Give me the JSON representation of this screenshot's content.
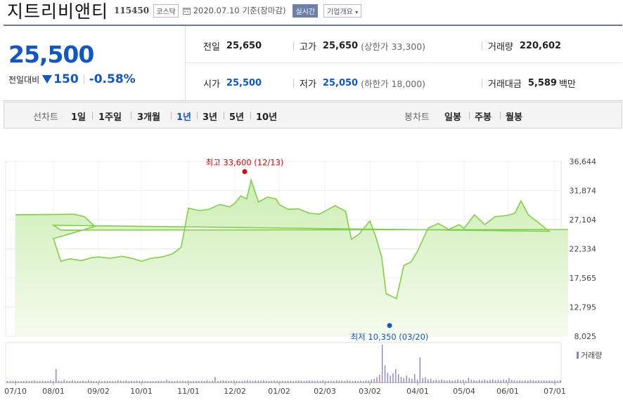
{
  "header": {
    "name": "지트리비앤티",
    "code": "115450",
    "market": "코스닥",
    "date": "2020.07.10",
    "basis": "기준(장마감)",
    "realtime_label": "실시간",
    "overview_label": "기업개요"
  },
  "quote": {
    "price": "25,500",
    "change_label": "전일대비",
    "change_abs": "150",
    "change_pct": "-0.58%",
    "direction": "down",
    "prev_close_label": "전일",
    "prev_close": "25,650",
    "high_label": "고가",
    "high": "25,650",
    "upper_limit": "(상한가 33,300)",
    "volume_label": "거래량",
    "volume": "220,602",
    "open_label": "시가",
    "open": "25,500",
    "low_label": "저가",
    "low": "25,050",
    "lower_limit": "(하한가 18,000)",
    "value_label": "거래대금",
    "value": "5,589",
    "value_unit": "백만"
  },
  "tabs": {
    "line_label": "선차트",
    "line_items": [
      "1일",
      "1주일",
      "3개월",
      "1년",
      "3년",
      "5년",
      "10년"
    ],
    "line_active": "1년",
    "candle_label": "봉차트",
    "candle_items": [
      "일봉",
      "주봉",
      "월봉"
    ]
  },
  "colors": {
    "up": "#e60000",
    "down": "#0f55cc",
    "line": "#7fd244",
    "volume": "#8c83c9"
  },
  "chart_data": {
    "type": "area",
    "x_ticks": [
      "07/10",
      "08/01",
      "09/02",
      "10/01",
      "11/01",
      "12/02",
      "01/02",
      "02/03",
      "03/02",
      "04/01",
      "05/04",
      "06/01",
      "07/01"
    ],
    "y_ticks": [
      "36,644",
      "31,874",
      "27,104",
      "22,334",
      "17,565",
      "12,795",
      "8,025"
    ],
    "ylim": [
      8025,
      36644
    ],
    "high_annotation": "최고 33,600 (12/13)",
    "low_annotation": "최저 10,350 (03/20)",
    "high": {
      "date": "12/13",
      "value": 33600
    },
    "low": {
      "date": "03/20",
      "value": 10350
    },
    "series": [
      {
        "name": "",
        "points": [
          [
            "07/10",
            27900
          ],
          [
            "07/15",
            28000
          ],
          [
            "07/22",
            27600
          ],
          [
            "07/29",
            26000
          ],
          [
            "08/01",
            24000
          ],
          [
            "08/06",
            20300
          ],
          [
            "08/12",
            20700
          ],
          [
            "08/20",
            20400
          ],
          [
            "08/27",
            20900
          ],
          [
            "09/02",
            21000
          ],
          [
            "09/10",
            20800
          ],
          [
            "09/18",
            21100
          ],
          [
            "09/26",
            20700
          ],
          [
            "10/01",
            20300
          ],
          [
            "10/08",
            20800
          ],
          [
            "10/15",
            21000
          ],
          [
            "10/22",
            21500
          ],
          [
            "10/28",
            22600
          ],
          [
            "11/01",
            29000
          ],
          [
            "11/08",
            28600
          ],
          [
            "11/15",
            28800
          ],
          [
            "11/22",
            29600
          ],
          [
            "11/29",
            29200
          ],
          [
            "12/02",
            29800
          ],
          [
            "12/06",
            31000
          ],
          [
            "12/10",
            30500
          ],
          [
            "12/13",
            33600
          ],
          [
            "12/18",
            30000
          ],
          [
            "12/24",
            30800
          ],
          [
            "12/30",
            30500
          ],
          [
            "01/02",
            29600
          ],
          [
            "01/08",
            28800
          ],
          [
            "01/15",
            28900
          ],
          [
            "01/22",
            28200
          ],
          [
            "01/29",
            28000
          ],
          [
            "02/03",
            28500
          ],
          [
            "02/10",
            29400
          ],
          [
            "02/17",
            28500
          ],
          [
            "02/21",
            23900
          ],
          [
            "02/26",
            24700
          ],
          [
            "03/02",
            26900
          ],
          [
            "03/06",
            24300
          ],
          [
            "03/10",
            21000
          ],
          [
            "03/13",
            15000
          ],
          [
            "03/20",
            14200
          ],
          [
            "03/25",
            19600
          ],
          [
            "03/30",
            20200
          ],
          [
            "04/01",
            22000
          ],
          [
            "04/08",
            25700
          ],
          [
            "04/15",
            26500
          ],
          [
            "04/22",
            25500
          ],
          [
            "04/29",
            26300
          ],
          [
            "05/04",
            25700
          ],
          [
            "05/11",
            27900
          ],
          [
            "05/18",
            26300
          ],
          [
            "05/25",
            27600
          ],
          [
            "06/01",
            27800
          ],
          [
            "06/06",
            28200
          ],
          [
            "06/10",
            30200
          ],
          [
            "06/15",
            27900
          ],
          [
            "06/22",
            26600
          ],
          [
            "06/29",
            25200
          ],
          [
            "07/01",
            26200
          ],
          [
            "07/06",
            25400
          ],
          [
            "07/10",
            25500
          ]
        ]
      }
    ],
    "volume_label": "거래량",
    "volume_rel": [
      0.04,
      0.03,
      0.04,
      0.05,
      0.03,
      0.04,
      0.03,
      0.05,
      0.04,
      0.05,
      0.06,
      0.03,
      0.04,
      0.05,
      0.04,
      0.03,
      0.06,
      0.04,
      0.35,
      0.05,
      0.04,
      0.07,
      0.05,
      0.04,
      0.06,
      0.05,
      0.04,
      0.03,
      0.05,
      0.04,
      0.06,
      0.05,
      0.04,
      0.03,
      0.05,
      0.04,
      0.04,
      0.05,
      0.04,
      0.03,
      0.04,
      0.06,
      0.05,
      0.04,
      0.06,
      0.04,
      0.05,
      0.04,
      0.05,
      0.04,
      0.05,
      0.04,
      0.03,
      0.04,
      0.03,
      0.04,
      0.05,
      0.04,
      0.03,
      0.07,
      0.05,
      0.04,
      0.03,
      0.05,
      0.04,
      0.05,
      0.04,
      0.05,
      0.03,
      0.04,
      0.05,
      0.04,
      0.05,
      0.04,
      0.06,
      0.04,
      0.05,
      0.15,
      0.04,
      0.05,
      0.06,
      0.05,
      0.04,
      0.05,
      0.06,
      0.05,
      0.04,
      0.03,
      0.05,
      0.06,
      0.05,
      0.04,
      0.06,
      0.05,
      0.05,
      0.06,
      0.05,
      0.04,
      0.05,
      0.06,
      0.05,
      0.04,
      0.05,
      0.04,
      0.05,
      0.05,
      0.04,
      0.05,
      0.06,
      0.05,
      0.04,
      0.05,
      0.06,
      0.05,
      0.04,
      0.05,
      0.04,
      0.06,
      0.05,
      0.04,
      0.05,
      0.04,
      0.06,
      0.05,
      0.05,
      0.04,
      0.06,
      0.05,
      0.04,
      0.05,
      0.04,
      0.05,
      0.04,
      0.06,
      0.05,
      0.08,
      0.1,
      0.14,
      0.2,
      0.98,
      0.45,
      0.25,
      0.18,
      0.24,
      0.35,
      0.22,
      0.15,
      0.12,
      0.18,
      0.12,
      0.1,
      0.22,
      0.08,
      0.65,
      0.12,
      0.14,
      0.08,
      0.1,
      0.06,
      0.07,
      0.06,
      0.08,
      0.06,
      0.05,
      0.07,
      0.05,
      0.06,
      0.08,
      0.06,
      0.07,
      0.05,
      0.12,
      0.07,
      0.06,
      0.05,
      0.07,
      0.06,
      0.08,
      0.06,
      0.07,
      0.08,
      0.06,
      0.07,
      0.06,
      0.08,
      0.07,
      0.12,
      0.07,
      0.06,
      0.05,
      0.06,
      0.05,
      0.06,
      0.05,
      0.07,
      0.06,
      0.05,
      0.06,
      0.05,
      0.06,
      0.05,
      0.06,
      0.05,
      0.06,
      0.05,
      0.06
    ]
  }
}
